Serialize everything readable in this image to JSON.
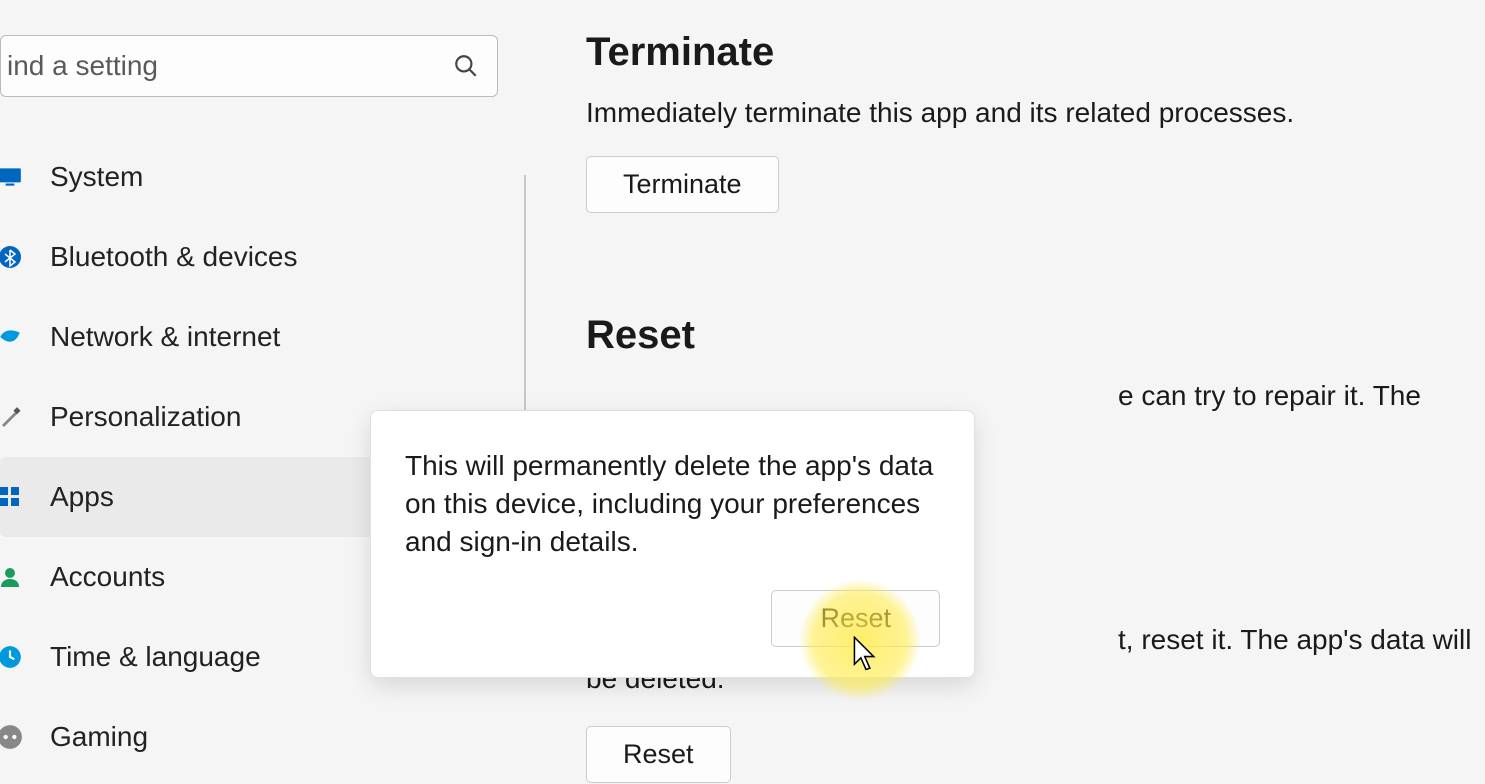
{
  "search": {
    "placeholder": "ind a setting"
  },
  "sidebar": {
    "items": [
      {
        "label": "System",
        "icon": "system"
      },
      {
        "label": "Bluetooth & devices",
        "icon": "bluetooth"
      },
      {
        "label": "Network & internet",
        "icon": "network"
      },
      {
        "label": "Personalization",
        "icon": "personalization"
      },
      {
        "label": "Apps",
        "icon": "apps"
      },
      {
        "label": "Accounts",
        "icon": "accounts"
      },
      {
        "label": "Time & language",
        "icon": "time"
      },
      {
        "label": "Gaming",
        "icon": "gaming"
      }
    ],
    "selected_index": 4
  },
  "content": {
    "terminate": {
      "title": "Terminate",
      "desc": "Immediately terminate this app and its related processes.",
      "button": "Terminate"
    },
    "reset": {
      "title": "Reset",
      "desc1_suffix": "e can try to repair it. The app's data",
      "desc2_suffix": "t, reset it. The app's data will be deleted.",
      "button": "Reset"
    }
  },
  "flyout": {
    "text": "This will permanently delete the app's data on this device, including your preferences and sign-in details.",
    "button": "Reset"
  }
}
